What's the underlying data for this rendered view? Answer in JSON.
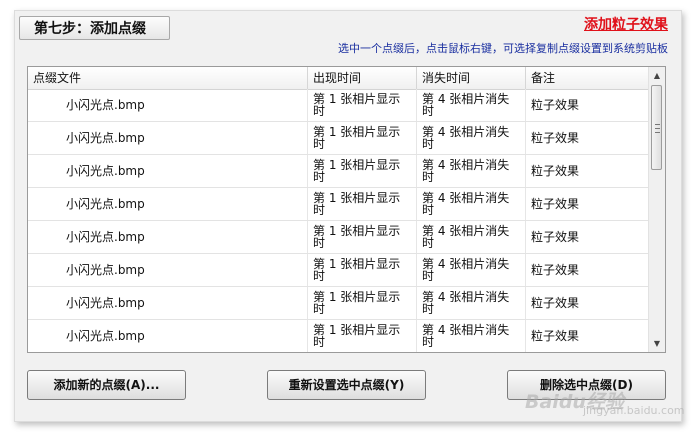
{
  "step_tab": "第七步：添加点缀",
  "title_link": "添加粒子效果",
  "hint": "选中一个点缀后，点击鼠标右键，可选择复制点缀设置到系统剪贴板",
  "table": {
    "headers": [
      "点缀文件",
      "出现时间",
      "消失时间",
      "备注"
    ],
    "rows": [
      {
        "file": "小闪光点.bmp",
        "appear": "第 1 张相片显示时",
        "disappear": "第 4 张相片消失时",
        "note": "粒子效果"
      },
      {
        "file": "小闪光点.bmp",
        "appear": "第 1 张相片显示时",
        "disappear": "第 4 张相片消失时",
        "note": "粒子效果"
      },
      {
        "file": "小闪光点.bmp",
        "appear": "第 1 张相片显示时",
        "disappear": "第 4 张相片消失时",
        "note": "粒子效果"
      },
      {
        "file": "小闪光点.bmp",
        "appear": "第 1 张相片显示时",
        "disappear": "第 4 张相片消失时",
        "note": "粒子效果"
      },
      {
        "file": "小闪光点.bmp",
        "appear": "第 1 张相片显示时",
        "disappear": "第 4 张相片消失时",
        "note": "粒子效果"
      },
      {
        "file": "小闪光点.bmp",
        "appear": "第 1 张相片显示时",
        "disappear": "第 4 张相片消失时",
        "note": "粒子效果"
      },
      {
        "file": "小闪光点.bmp",
        "appear": "第 1 张相片显示时",
        "disappear": "第 4 张相片消失时",
        "note": "粒子效果"
      },
      {
        "file": "小闪光点.bmp",
        "appear": "第 1 张相片显示时",
        "disappear": "第 4 张相片消失时",
        "note": "粒子效果"
      }
    ]
  },
  "scrollbar": {
    "up_icon": "▲",
    "down_icon": "▼"
  },
  "buttons": {
    "add": "添加新的点缀(A)...",
    "reset": "重新设置选中点缀(Y)",
    "delete": "删除选中点缀(D)"
  },
  "watermark": "Baidu经验",
  "watermark_sub": "jingyan.baidu.com",
  "colors": {
    "title_link": "#e0111a",
    "hint": "#1a2fa0"
  }
}
